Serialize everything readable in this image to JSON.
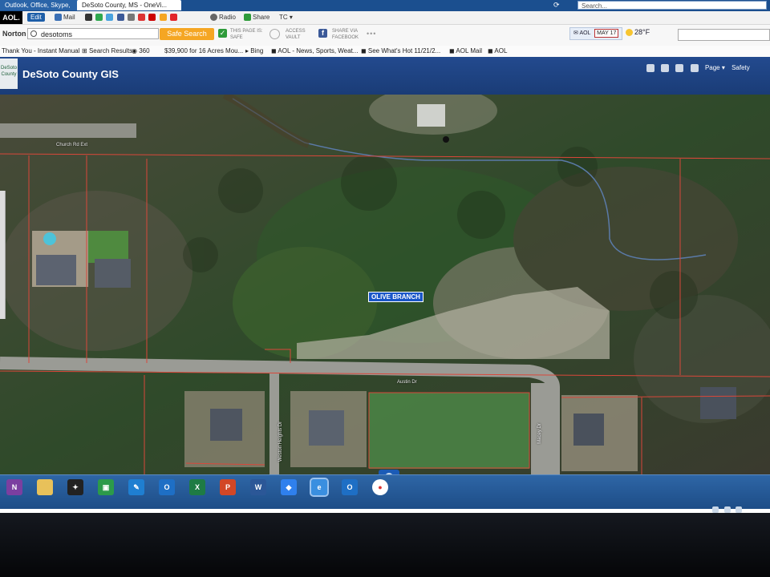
{
  "browser": {
    "tabs": [
      {
        "label": "Outlook, Office, Skype,"
      },
      {
        "label": "DeSoto County, MS - OneVi..."
      }
    ],
    "search_placeholder": "Search...",
    "toolbar": {
      "aol_logo": "AOL.",
      "edit": "Edit",
      "mail": "Mail",
      "radio": "Radio",
      "share": "Share",
      "tc": "TC"
    },
    "norton": {
      "label": "Norton",
      "search_value": "desotoms",
      "safe_search": "Safe Search",
      "page_is_safe_1": "THIS PAGE IS:",
      "page_is_safe_2": "SAFE",
      "access_vault_1": "ACCESS",
      "access_vault_2": "VAULT",
      "share_via_1": "SHARE VIA",
      "share_via_2": "FACEBOOK",
      "more": "•••"
    },
    "mail_widget": {
      "brand": "AOL",
      "date": "MAY 17"
    },
    "weather": {
      "temp": "28°F"
    },
    "favorites": [
      "Thank You - Instant Manual",
      "Search Results",
      "360",
      "$39,900 for 16 Acres Mou...",
      "Bing",
      "AOL - News, Sports, Weat...",
      "See What's Hot 11/21/2...",
      "AOL Mail",
      "AOL"
    ],
    "page_tools": {
      "page": "Page",
      "safety": "Safety"
    }
  },
  "gis": {
    "logo": "DeSoto County",
    "title": "DeSoto County GIS",
    "map_label": "OLIVE BRANCH",
    "road_labels": {
      "church_rd": "Church Rd Ext",
      "austin_dr": "Austin Dr",
      "weston_heights": "Weston Heights Dr",
      "macey_dr": "Macey Dr"
    }
  },
  "taskbar": {
    "apps": [
      "onenote",
      "file-explorer",
      "photos",
      "store",
      "feather",
      "outlook",
      "excel",
      "powerpoint",
      "word",
      "dropbox",
      "internet-explorer",
      "outlook-2",
      "chrome"
    ]
  }
}
